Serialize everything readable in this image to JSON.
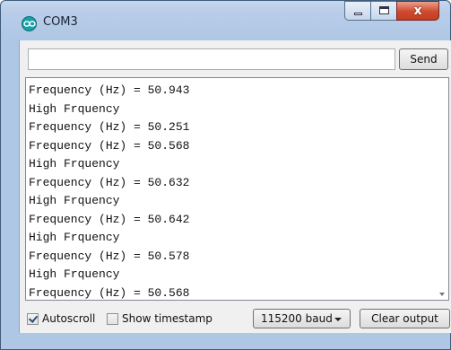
{
  "window": {
    "title": "COM3",
    "app_icon": "arduino-icon",
    "controls": {
      "minimize": "minimize-icon",
      "maximize": "maximize-icon",
      "close": "x"
    }
  },
  "input": {
    "value": "",
    "placeholder": ""
  },
  "send_label": "Send",
  "output_lines": [
    "Frequency (Hz) = 50.943",
    "High Frquency",
    "Frequency (Hz) = 50.251",
    "Frequency (Hz) = 50.568",
    "High Frquency",
    "Frequency (Hz) = 50.632",
    "High Frquency",
    "Frequency (Hz) = 50.642",
    "High Frquency",
    "Frequency (Hz) = 50.578",
    "High Frquency",
    "Frequency (Hz) = 50.568"
  ],
  "footer": {
    "autoscroll_label": "Autoscroll",
    "autoscroll_checked": true,
    "timestamp_label": "Show timestamp",
    "timestamp_checked": false,
    "baud_selected": "115200 baud",
    "clear_label": "Clear output"
  },
  "colors": {
    "title_bar": "#b9cde9",
    "close_button": "#cf4a2d",
    "app_icon": "#18a0a6"
  }
}
